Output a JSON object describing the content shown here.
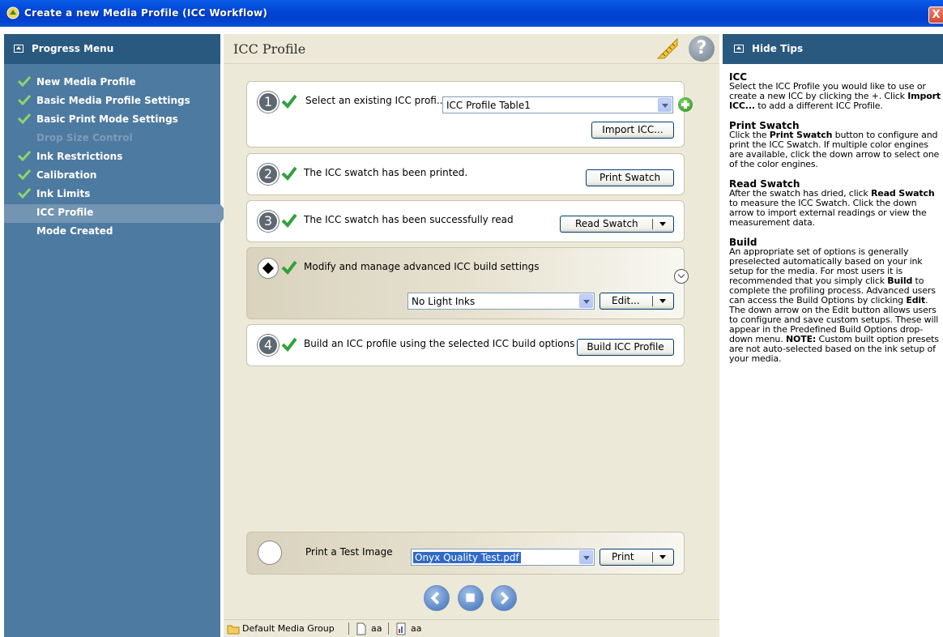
{
  "window": {
    "title": "Create a new Media Profile (ICC Workflow)",
    "close_label": "X"
  },
  "progress_menu": {
    "header": "Progress Menu",
    "items": [
      {
        "label": "New Media Profile",
        "state": "done"
      },
      {
        "label": "Basic Media Profile Settings",
        "state": "done"
      },
      {
        "label": "Basic Print Mode Settings",
        "state": "done"
      },
      {
        "label": "Drop Size Control",
        "state": "disabled"
      },
      {
        "label": "Ink Restrictions",
        "state": "done"
      },
      {
        "label": "Calibration",
        "state": "done"
      },
      {
        "label": "Ink Limits",
        "state": "done"
      },
      {
        "label": "ICC Profile",
        "state": "active"
      },
      {
        "label": "Mode Created",
        "state": "pending"
      }
    ]
  },
  "main": {
    "title": "ICC Profile",
    "help_label": "?",
    "step1": {
      "number": "1",
      "text": "Select an existing ICC profi...",
      "combo_value": "ICC Profile Table1",
      "import_label": "Import ICC..."
    },
    "step2": {
      "number": "2",
      "text": "The ICC swatch has been printed.",
      "button_label": "Print Swatch"
    },
    "step3": {
      "number": "3",
      "text": "The ICC swatch has been successfully read",
      "button_label": "Read Swatch"
    },
    "advanced": {
      "text": "Modify and manage advanced ICC build settings",
      "combo_value": "No Light Inks",
      "edit_label": "Edit..."
    },
    "step4": {
      "number": "4",
      "text": "Build an ICC profile using the selected ICC build options",
      "button_label": "Build ICC Profile"
    },
    "test_image": {
      "text": "Print a Test Image",
      "combo_value": "Onyx Quality Test.pdf",
      "print_label": "Print"
    }
  },
  "statusbar": {
    "group": "Default Media Group",
    "item2": "aa",
    "item3": "aa"
  },
  "tips": {
    "header": "Hide Tips",
    "sections": [
      {
        "title": "ICC"
      },
      {
        "title": "Print Swatch"
      },
      {
        "title": "Read Swatch"
      },
      {
        "title": "Build"
      }
    ],
    "icc_body_1": "Select the ICC Profile you would like to use or create a new ICC by clicking the +. Click ",
    "icc_bold_1": "Import ICC...",
    "icc_body_2": " to add a different ICC Profile.",
    "ps_body_1": "Click the ",
    "ps_bold_1": "Print Swatch",
    "ps_body_2": " button to configure and print the ICC Swatch. If multiple color engines are available, click the down arrow to select one of the color engines.",
    "rs_body_1": "After the swatch has dried, click ",
    "rs_bold_1": "Read Swatch",
    "rs_body_2": " to measure the ICC Swatch. Click the down arrow to import external readings or view the measurement data.",
    "b_body_1": "An appropriate set of options is generally preselected automatically based on your ink setup for the media. For most users it is recommended that you simply click ",
    "b_bold_1": "Build",
    "b_body_2": " to complete the profiling process. Advanced users can access the Build Options by clicking ",
    "b_bold_2": "Edit",
    "b_body_3": ". The down arrow on the Edit button allows users to configure and save custom setups. These will appear in the Predefined Build Options drop-down menu. ",
    "b_bold_3": "NOTE:",
    "b_body_4": " Custom built option presets are not auto-selected based on the ink setup of your media."
  },
  "colors": {
    "titlebar": "#0244d4",
    "panel_header": "#29597f",
    "progress_bg": "#4d7aa1",
    "check_green": "#2fa23a"
  }
}
